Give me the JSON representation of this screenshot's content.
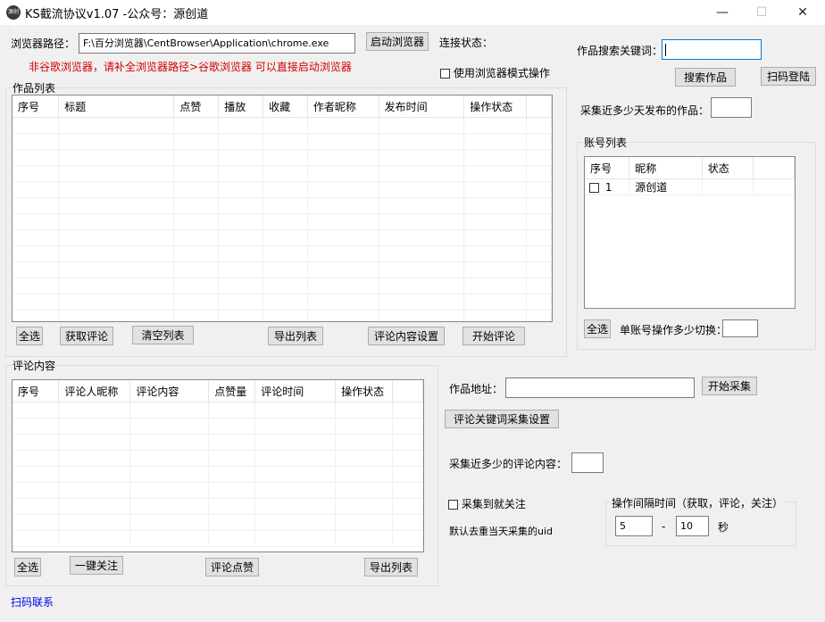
{
  "window": {
    "title": "KS截流协议v1.07 -公众号：源创道",
    "icon_text": "源创道",
    "minimize": "—",
    "maximize": "☐",
    "close": "✕"
  },
  "browser": {
    "path_label": "浏览器路径：",
    "path_value": "F:\\百分浏览器\\CentBrowser\\Application\\chrome.exe",
    "launch_button": "启动浏览器",
    "status_label": "连接状态：",
    "warning": "非谷歌浏览器，请补全浏览器路径>谷歌浏览器 可以直接启动浏览器",
    "browser_mode_label": "使用浏览器模式操作"
  },
  "search": {
    "keyword_label": "作品搜索关键词：",
    "keyword_value": "",
    "search_button": "搜索作品",
    "scan_login_button": "扫码登陆",
    "days_label": "采集近多少天发布的作品：",
    "days_value": ""
  },
  "works": {
    "title": "作品列表",
    "columns": [
      "序号",
      "标题",
      "点赞",
      "播放",
      "收藏",
      "作者昵称",
      "发布时间",
      "操作状态"
    ],
    "buttons": {
      "select_all": "全选",
      "get_comments": "获取评论",
      "clear": "清空列表",
      "export": "导出列表",
      "comment_settings": "评论内容设置",
      "start_comment": "开始评论"
    }
  },
  "accounts": {
    "title": "账号列表",
    "columns": [
      "序号",
      "昵称",
      "状态"
    ],
    "rows": [
      {
        "index": "1",
        "nickname": "源创道",
        "status": ""
      }
    ],
    "select_all": "全选",
    "switch_label": "单账号操作多少切换：",
    "switch_value": ""
  },
  "comments": {
    "title": "评论内容",
    "columns": [
      "序号",
      "评论人昵称",
      "评论内容",
      "点赞量",
      "评论时间",
      "操作状态"
    ],
    "buttons": {
      "select_all": "全选",
      "follow_all": "一键关注",
      "like_comments": "评论点赞",
      "export": "导出列表"
    }
  },
  "collect": {
    "url_label": "作品地址：",
    "url_value": "",
    "start_button": "开始采集",
    "keyword_settings_button": "评论关键词采集设置",
    "recent_label": "采集近多少的评论内容：",
    "recent_value": "",
    "auto_follow_label": "采集到就关注",
    "dedupe_note": "默认去重当天采集的uid"
  },
  "interval": {
    "title": "操作间隔时间（获取，评论，关注）",
    "min": "5",
    "dash": "-",
    "max": "10",
    "unit": "秒"
  },
  "footer": {
    "contact_link": "扫码联系"
  }
}
